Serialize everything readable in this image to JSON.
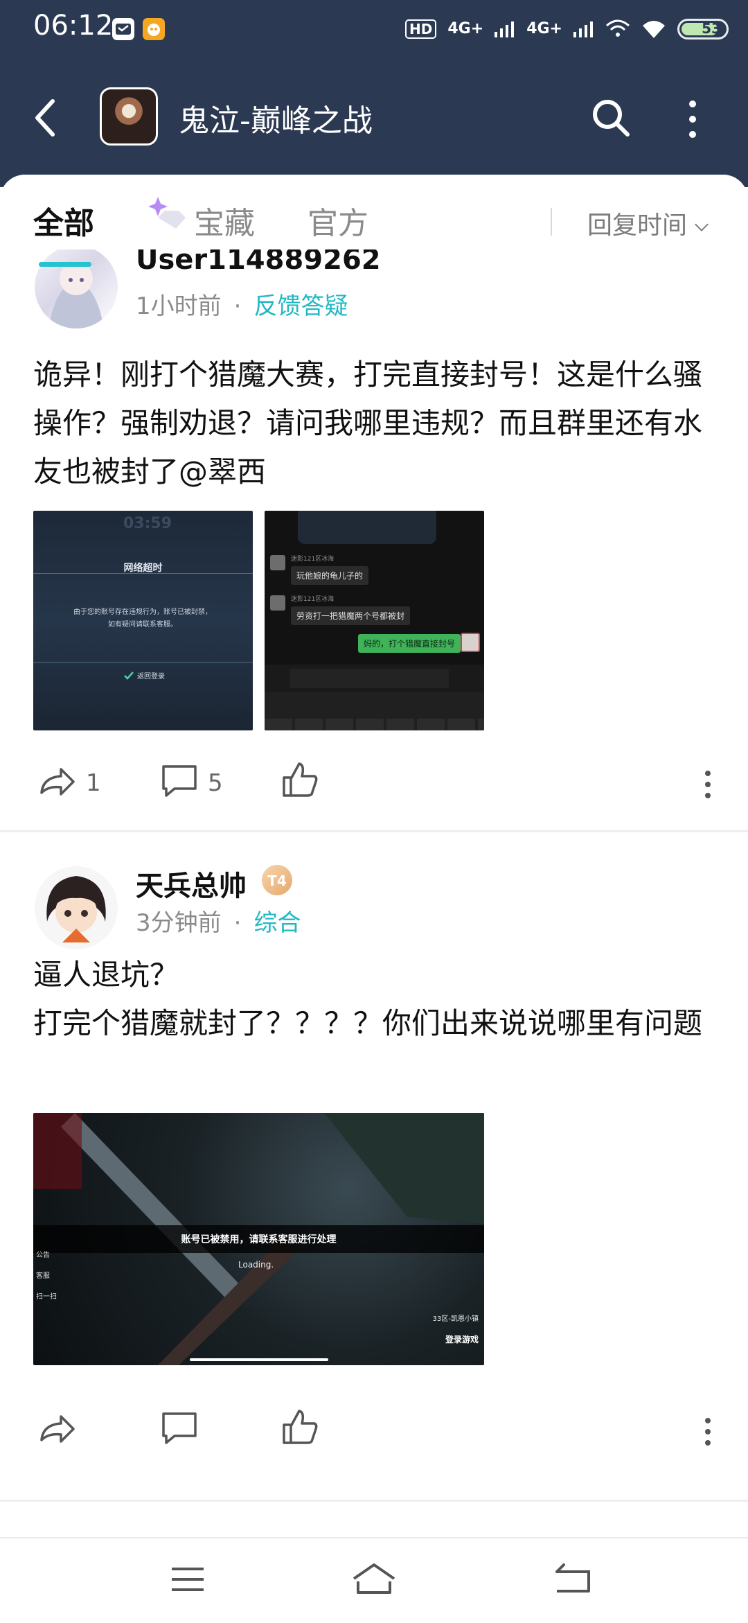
{
  "status": {
    "time": "06:12",
    "hd": "HD",
    "hd_sub": "1 2",
    "signal1": "4G+",
    "signal2": "4G+",
    "battery": "53"
  },
  "titlebar": {
    "title": "鬼泣-巅峰之战"
  },
  "tabs": {
    "all": "全部",
    "treasure": "宝藏",
    "official": "官方",
    "sort_label": "回复时间"
  },
  "posts": [
    {
      "username": "User114889262",
      "time": "1小时前",
      "category": "反馈答疑",
      "content": "诡异！刚打个猎魔大赛，打完直接封号！这是什么骚操作？强制劝退？请问我哪里违规？而且群里还有水友也被封了@翠西",
      "images": [
        {
          "time_overlay": "03:59",
          "dialog_title": "网络超时",
          "dialog_body": "由于您的账号存在违规行为，账号已被封禁，如有疑问请联系客服。",
          "dialog_button": "返回登录"
        },
        {
          "chat": [
            {
              "sender": "迷影121区冰海",
              "text": "玩他娘的龟儿子的"
            },
            {
              "sender": "迷影121区冰海",
              "text": "劳资打一把猎魔两个号都被封"
            },
            {
              "sender": "",
              "text": "妈的，打个猎魔直接封号"
            }
          ]
        }
      ],
      "shares": "1",
      "comments": "5"
    },
    {
      "username": "天兵总帅",
      "level": "T4",
      "time": "3分钟前",
      "category": "综合",
      "content": "逼人退坑？\n打完个猎魔就封了？？？？你们出来说说哪里有问题",
      "image": {
        "banner": "账号已被禁用，请联系客服进行处理",
        "loading": "Loading.",
        "menu": [
          "公告",
          "客服",
          "扫一扫"
        ],
        "server": "33区-凯恩小镇",
        "login": "登录游戏"
      }
    }
  ]
}
